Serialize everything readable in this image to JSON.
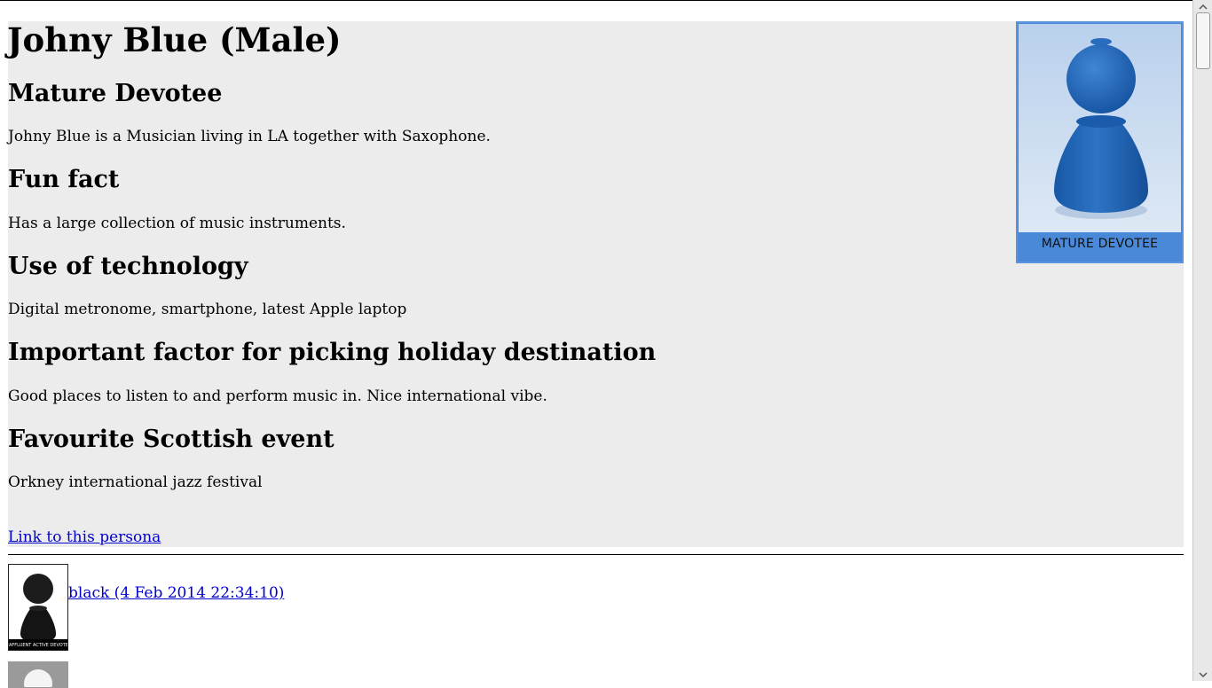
{
  "persona": {
    "title": "Johny Blue (Male)",
    "segment_heading": "Mature Devotee",
    "description": "Johny Blue is a Musician living in LA together with Saxophone.",
    "sections": [
      {
        "heading": "Fun fact",
        "text": "Has a large collection of music instruments."
      },
      {
        "heading": "Use of technology",
        "text": "Digital metronome, smartphone, latest Apple laptop"
      },
      {
        "heading": "Important factor for picking holiday destination",
        "text": "Good places to listen to and perform music in. Nice international vibe."
      },
      {
        "heading": "Favourite Scottish event",
        "text": "Orkney international jazz festival"
      }
    ],
    "link_label": "Link to this persona",
    "badge_caption": "MATURE DEVOTEE"
  },
  "related": [
    {
      "label": "black (4 Feb 2014 22:34:10)",
      "thumb_caption": "AFFLUENT ACTIVE DEVOTEE"
    }
  ],
  "colors": {
    "panel_bg": "#ececec",
    "link": "#0000cc",
    "badge_blue": "#4a88d8",
    "figure_blue": "#1f63b5"
  }
}
